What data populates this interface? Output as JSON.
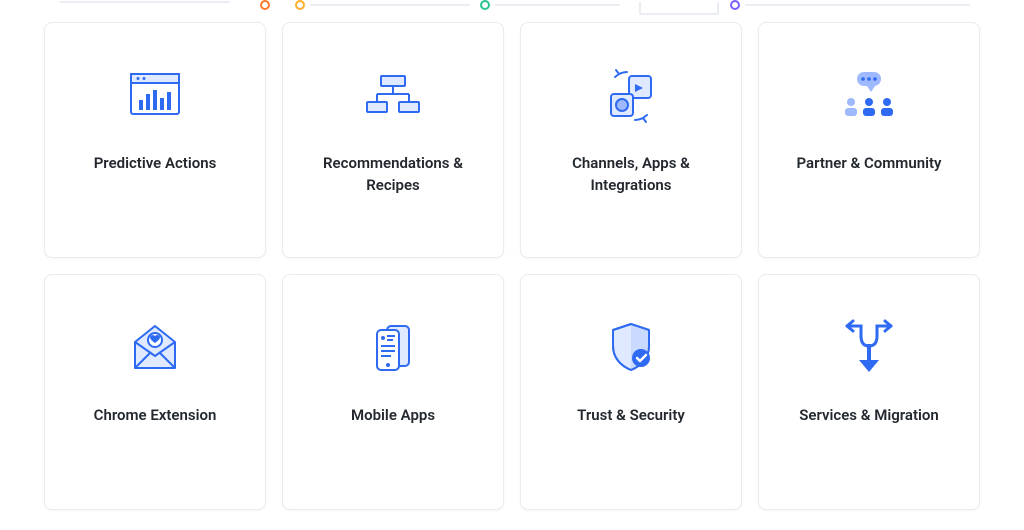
{
  "cards": [
    {
      "id": "predictive-actions",
      "title": "Predictive Actions",
      "icon": "chart-window-icon"
    },
    {
      "id": "recommendations-recipes",
      "title": "Recommendations & Recipes",
      "icon": "flowchart-icon"
    },
    {
      "id": "channels-apps-integrations",
      "title": "Channels, Apps & Integrations",
      "icon": "apps-sync-icon"
    },
    {
      "id": "partner-community",
      "title": "Partner & Community",
      "icon": "community-icon"
    },
    {
      "id": "chrome-extension",
      "title": "Chrome Extension",
      "icon": "envelope-heart-icon"
    },
    {
      "id": "mobile-apps",
      "title": "Mobile Apps",
      "icon": "mobile-apps-icon"
    },
    {
      "id": "trust-security",
      "title": "Trust & Security",
      "icon": "shield-check-icon"
    },
    {
      "id": "services-migration",
      "title": "Services & Migration",
      "icon": "migration-arrow-icon"
    }
  ],
  "colors": {
    "primary": "#2f6af2",
    "primary_light": "#dfe9ff",
    "text": "#23282f",
    "border": "#e9ebf0"
  }
}
